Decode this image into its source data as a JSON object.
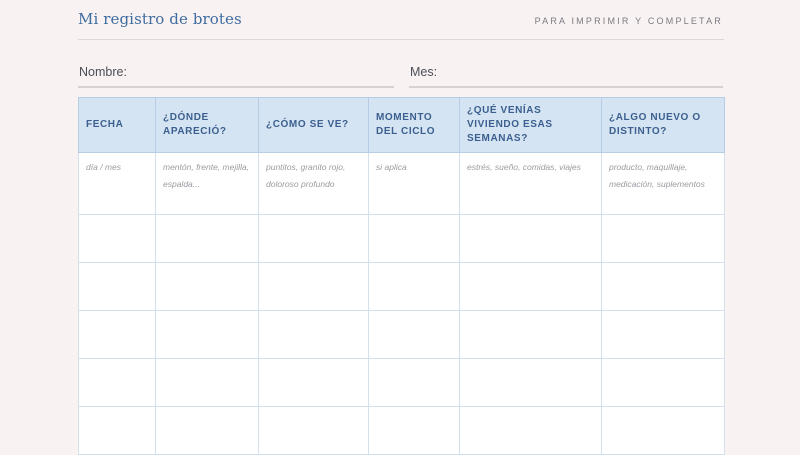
{
  "header": {
    "title": "Mi registro de brotes",
    "subtitle": "PARA IMPRIMIR Y COMPLETAR"
  },
  "fields": {
    "name_label": "Nombre:",
    "month_label": "Mes:"
  },
  "table": {
    "columns": [
      "FECHA",
      "¿DÓNDE APARECIÓ?",
      "¿CÓMO SE VE?",
      "MOMENTO DEL CICLO",
      "¿QUÉ VENÍAS VIVIENDO ESAS SEMANAS?",
      "¿ALGO NUEVO O DISTINTO?"
    ],
    "example_row": [
      "día / mes",
      "mentón, frente, mejilla, espalda...",
      "puntitos, granito rojo, doloroso profundo",
      "si aplica",
      "estrés, sueño, comidas, viajes",
      "producto, maquillaje, medicación, suplementos"
    ]
  },
  "colors": {
    "accent": "#3f6b9f",
    "header_fill": "#d5e4f2",
    "page_background": "#f8f3f2"
  }
}
